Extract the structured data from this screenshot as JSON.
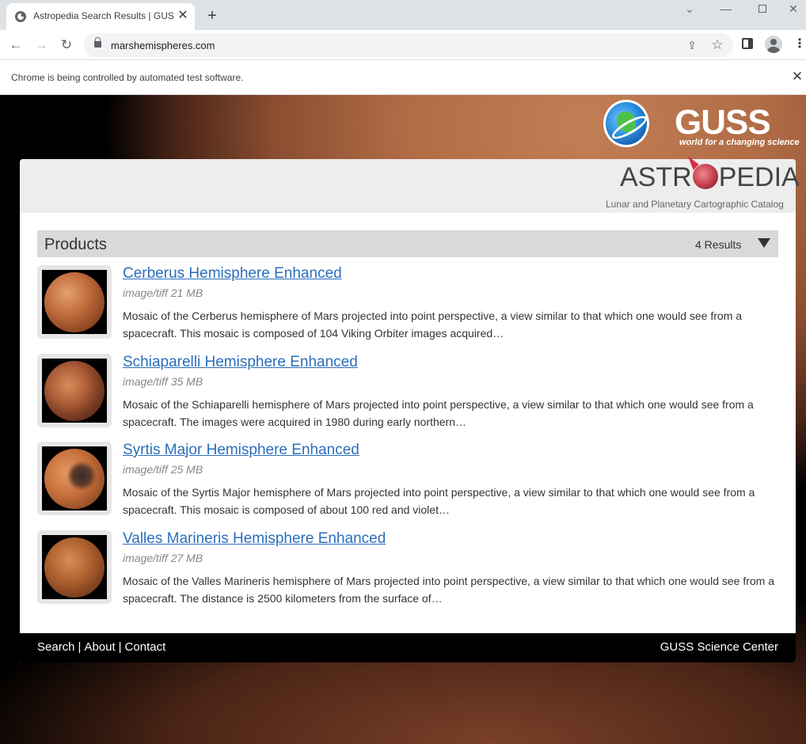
{
  "browser": {
    "tab_title": "Astropedia Search Results | GUSS",
    "url": "marshemispheres.com",
    "infobar_text": "Chrome is being controlled by automated test software."
  },
  "header": {
    "logo_brand": "GUSS",
    "logo_tagline": "world for a changing science",
    "astro_logo_left": "ASTR",
    "astro_logo_right": "PEDIA",
    "astro_subtitle": "Lunar and Planetary Cartographic Catalog"
  },
  "products": {
    "title": "Products",
    "results_count": "4 Results"
  },
  "results": [
    {
      "title": "Cerberus Hemisphere Enhanced",
      "meta": "image/tiff 21 MB",
      "description": "Mosaic of the Cerberus hemisphere of Mars projected into point perspective, a view similar to that which one would see from a spacecraft. This mosaic is composed of 104 Viking Orbiter images acquired…"
    },
    {
      "title": "Schiaparelli Hemisphere Enhanced",
      "meta": "image/tiff 35 MB",
      "description": "Mosaic of the Schiaparelli hemisphere of Mars projected into point perspective, a view similar to that which one would see from a spacecraft. The images were acquired in 1980 during early northern…"
    },
    {
      "title": "Syrtis Major Hemisphere Enhanced",
      "meta": "image/tiff 25 MB",
      "description": "Mosaic of the Syrtis Major hemisphere of Mars projected into point perspective, a view similar to that which one would see from a spacecraft. This mosaic is composed of about 100 red and violet…"
    },
    {
      "title": "Valles Marineris Hemisphere Enhanced",
      "meta": "image/tiff 27 MB",
      "description": "Mosaic of the Valles Marineris hemisphere of Mars projected into point perspective, a view similar to that which one would see from a spacecraft. The distance is 2500 kilometers from the surface of…"
    }
  ],
  "footer": {
    "search": "Search",
    "about": "About",
    "contact": "Contact",
    "separator": "|",
    "right": "GUSS Science Center"
  },
  "colors": {
    "link": "#2a6ebb",
    "products_bar": "#d9d9d9",
    "footer_bg": "#000000"
  }
}
